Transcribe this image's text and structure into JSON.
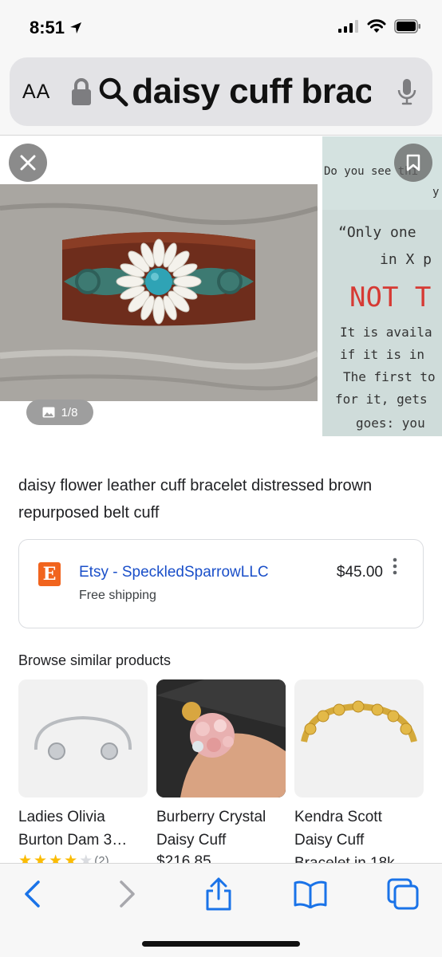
{
  "status_bar": {
    "time": "8:51",
    "icons": [
      "location-arrow-icon",
      "cellular-signal-icon",
      "wifi-icon",
      "battery-icon"
    ]
  },
  "address_bar": {
    "text_size_label": "AA",
    "query": "daisy cuff brac",
    "icons": [
      "lock-icon",
      "search-icon",
      "microphone-icon"
    ]
  },
  "carousel": {
    "counter": "1/8",
    "side_image_lines": [
      "Do you see thi",
      "y",
      "“Only one",
      "in X p",
      "NOT T",
      "It is availa",
      "if it is in",
      "The first to",
      "for it, gets",
      "goes: you"
    ]
  },
  "product": {
    "title": "daisy flower leather cuff bracelet distressed brown repurposed belt cuff",
    "seller_logo": "E",
    "seller": "Etsy - SpeckledSparrowLLC",
    "shipping": "Free shipping",
    "price": "$45.00"
  },
  "similar": {
    "heading": "Browse similar products",
    "items": [
      {
        "line1": "Ladies Olivia",
        "line2": "Burton Dam 3…",
        "rating_count": "(2)",
        "rating": 3.5
      },
      {
        "line1": "Burberry Crystal",
        "line2": "Daisy Cuff",
        "price": "$216.85"
      },
      {
        "line1": "Kendra Scott",
        "line2": "Daisy Cuff",
        "line3": "Bracelet in 18k…"
      }
    ]
  },
  "toolbar": {
    "buttons": [
      "back-icon",
      "forward-icon",
      "share-icon",
      "bookmarks-icon",
      "tabs-icon"
    ]
  },
  "colors": {
    "accent": "#1a73e8",
    "etsy": "#f1641e",
    "link": "#1a4fc9",
    "star": "#fbbc04"
  }
}
